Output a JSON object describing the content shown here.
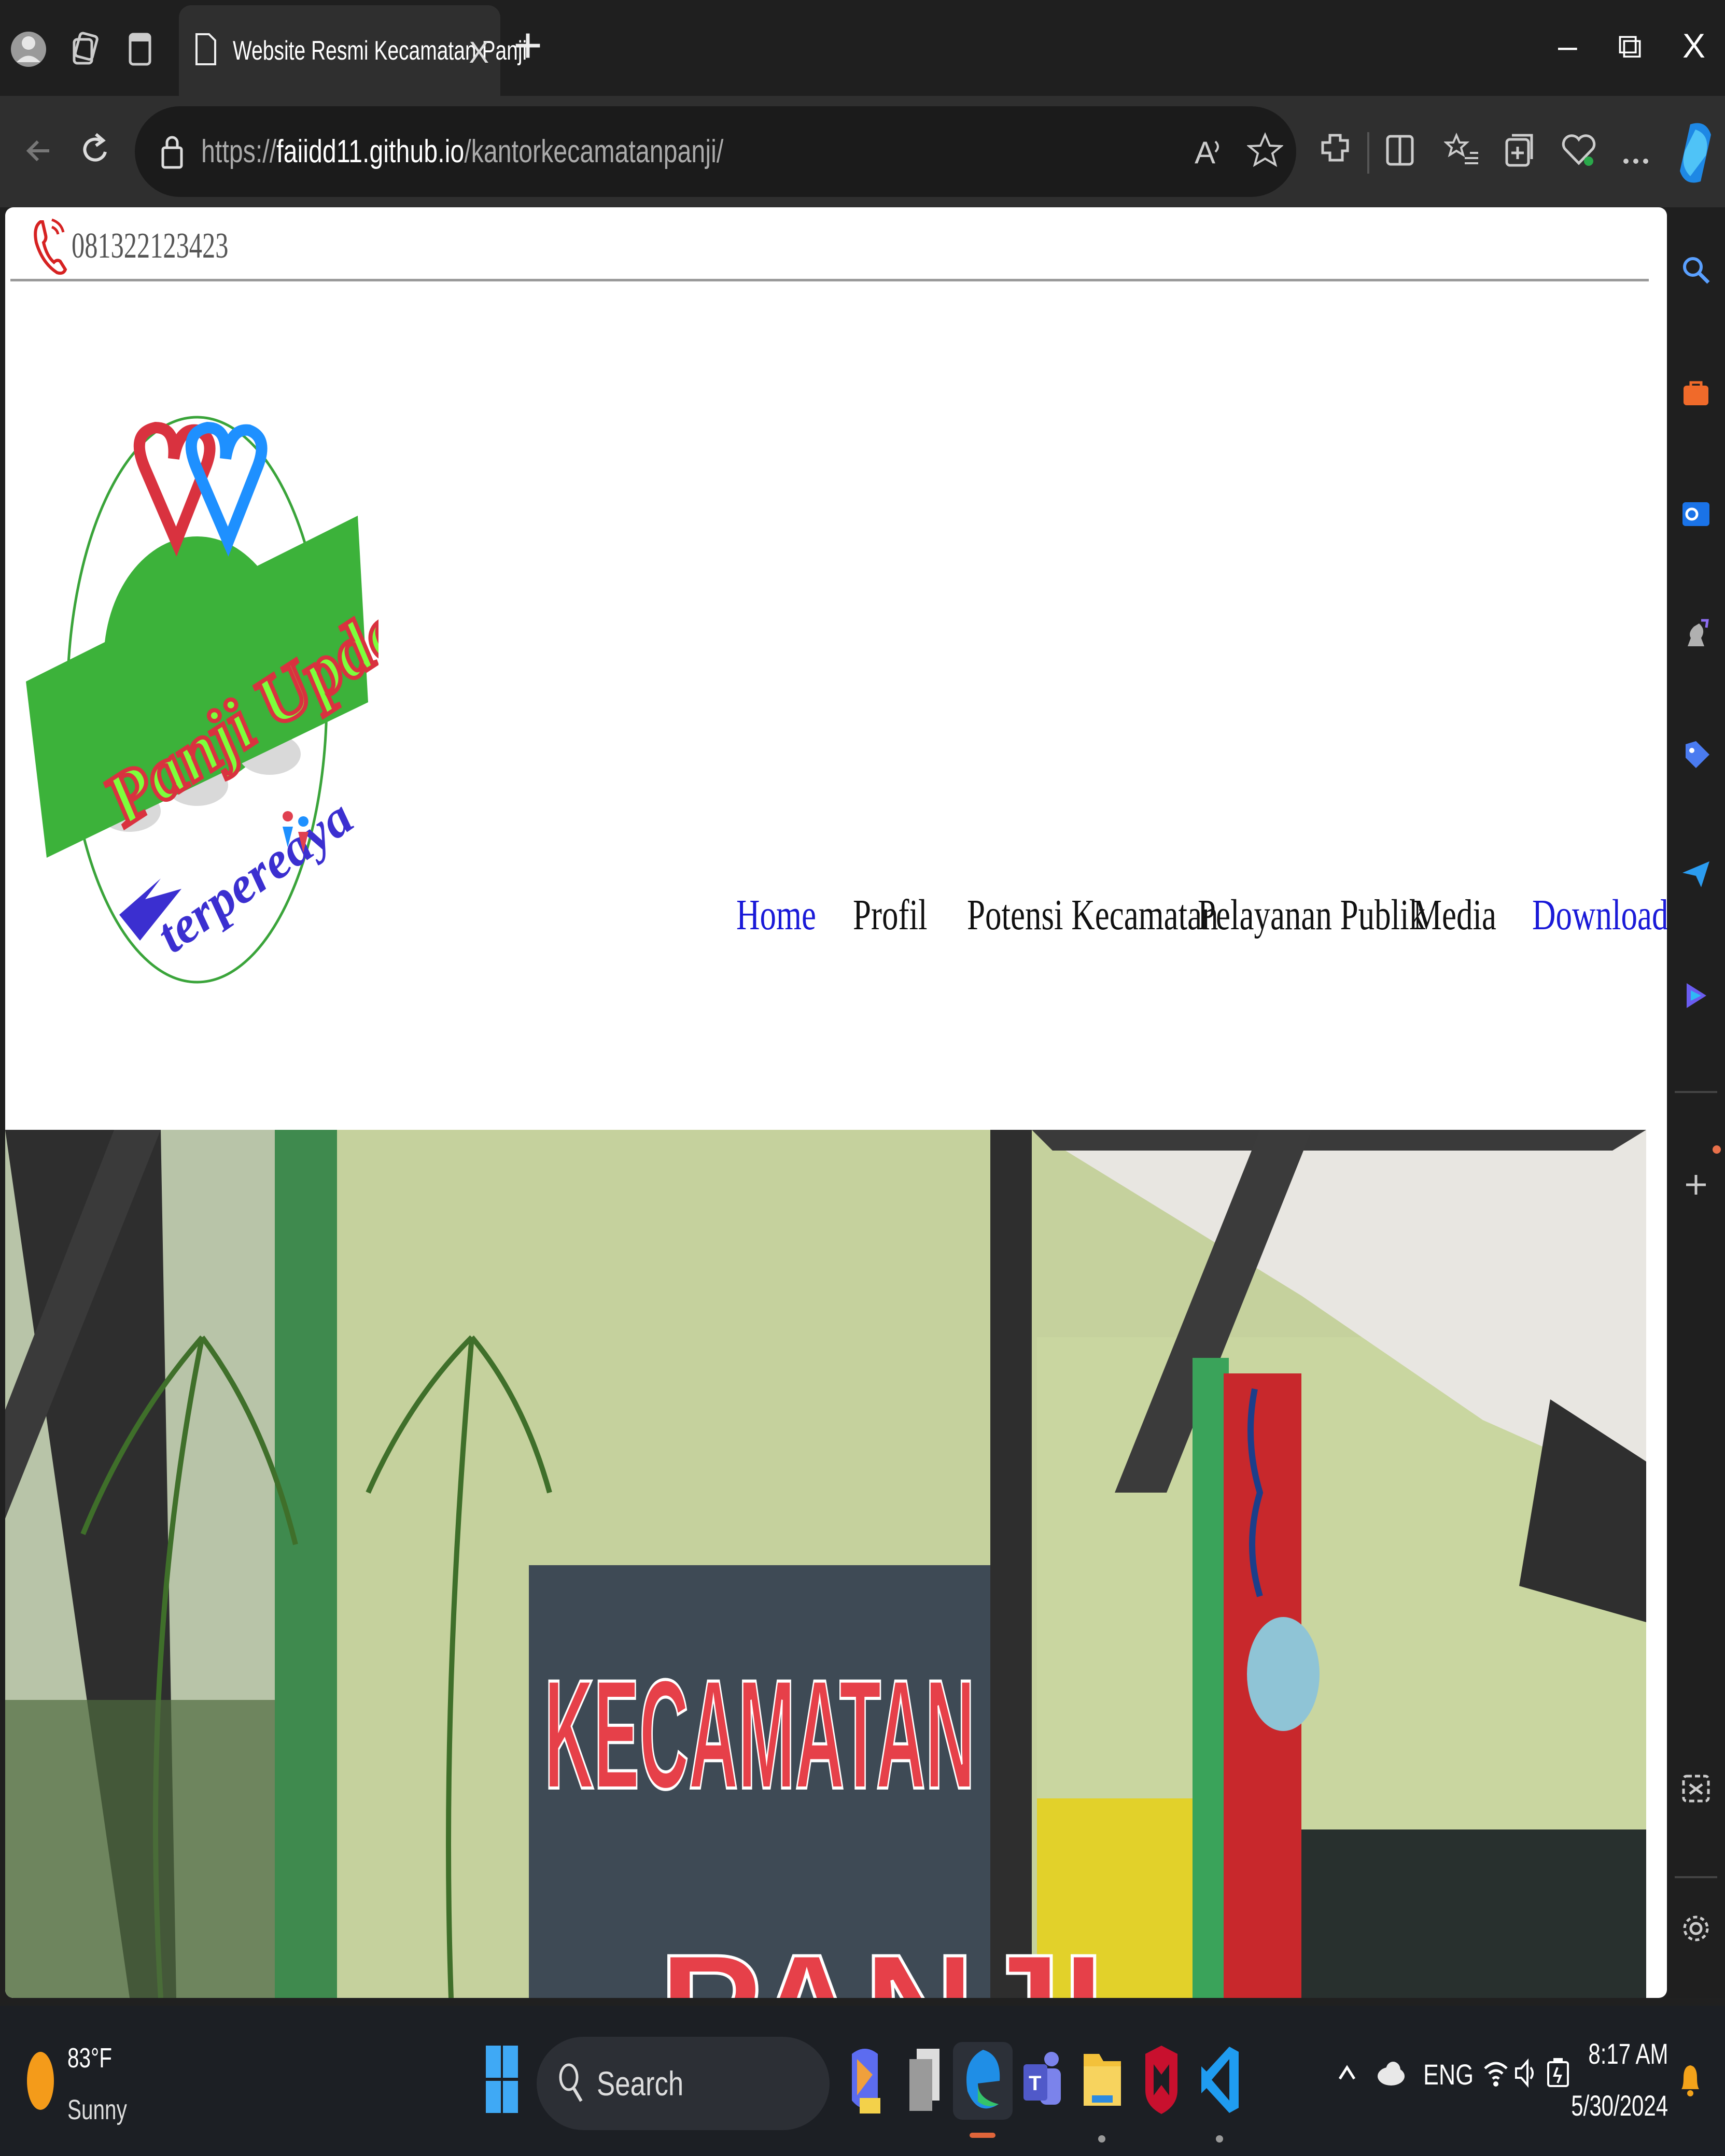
{
  "browser": {
    "tab_title": "Website Resmi Kecamatan Panji",
    "tab_close_label": "X",
    "new_tab_label": "+",
    "url_prefix": "https://",
    "url_host": "faiidd11.github.io",
    "url_path": "/kantorkecamatanpanji/",
    "window_controls": {
      "minimize": "–",
      "restore": "⧉",
      "close": "X"
    }
  },
  "page": {
    "contact_phone": "081322123423",
    "logo": {
      "line1": "Panji Update",
      "line2": "terpereaya"
    },
    "nav": [
      {
        "label": "Home",
        "active": true
      },
      {
        "label": "Profil",
        "active": false
      },
      {
        "label": "Potensi Kecamatan",
        "active": false
      },
      {
        "label": "Pelayanan Publik",
        "active": false
      },
      {
        "label": "Media",
        "active": false
      },
      {
        "label": "Download",
        "active": true
      }
    ],
    "hero": {
      "sign_line1": "KECAMATAN",
      "sign_line2": "PANJI"
    }
  },
  "taskbar": {
    "weather_temp": "83°F",
    "weather_desc": "Sunny",
    "search_label": "Search",
    "tray_lang": "ENG",
    "time": "8:17 AM",
    "date": "5/30/2024"
  },
  "colors": {
    "nav_link_blue": "#1a1ad8",
    "scroll_top_button": "#0b12ea",
    "logo_green": "#3cb23a",
    "sign_red": "#d9323f"
  }
}
